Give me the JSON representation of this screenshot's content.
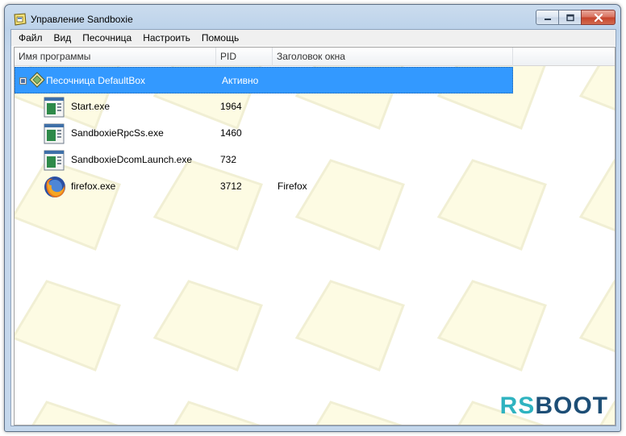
{
  "window": {
    "title": "Управление Sandboxie",
    "icon": "sandboxie-app-icon",
    "controls": [
      "minimize-icon",
      "maximize-icon",
      "close-icon"
    ]
  },
  "menu": {
    "items": [
      "Файл",
      "Вид",
      "Песочница",
      "Настроить",
      "Помощь"
    ]
  },
  "columns": {
    "name": "Имя программы",
    "pid": "PID",
    "title": "Заголовок окна"
  },
  "sandbox": {
    "name": "Песочница DefaultBox",
    "status": "Активно",
    "expander": "collapse-box-icon",
    "icon": "sandbox-icon"
  },
  "processes": [
    {
      "name": "Start.exe",
      "pid": "1964",
      "title": "",
      "icon": "app-window-icon"
    },
    {
      "name": "SandboxieRpcSs.exe",
      "pid": "1460",
      "title": "",
      "icon": "app-window-icon"
    },
    {
      "name": "SandboxieDcomLaunch.exe",
      "pid": "732",
      "title": "",
      "icon": "app-window-icon"
    },
    {
      "name": "firefox.exe",
      "pid": "3712",
      "title": "Firefox",
      "icon": "firefox-icon"
    }
  ],
  "watermark": {
    "rs": "RS",
    "boot": "BOOT"
  },
  "colors": {
    "selection": "#3399ff",
    "background_pattern": "#fdfbe3",
    "watermark_rs": "#2fb3c0",
    "watermark_boot": "#1d4e76"
  }
}
